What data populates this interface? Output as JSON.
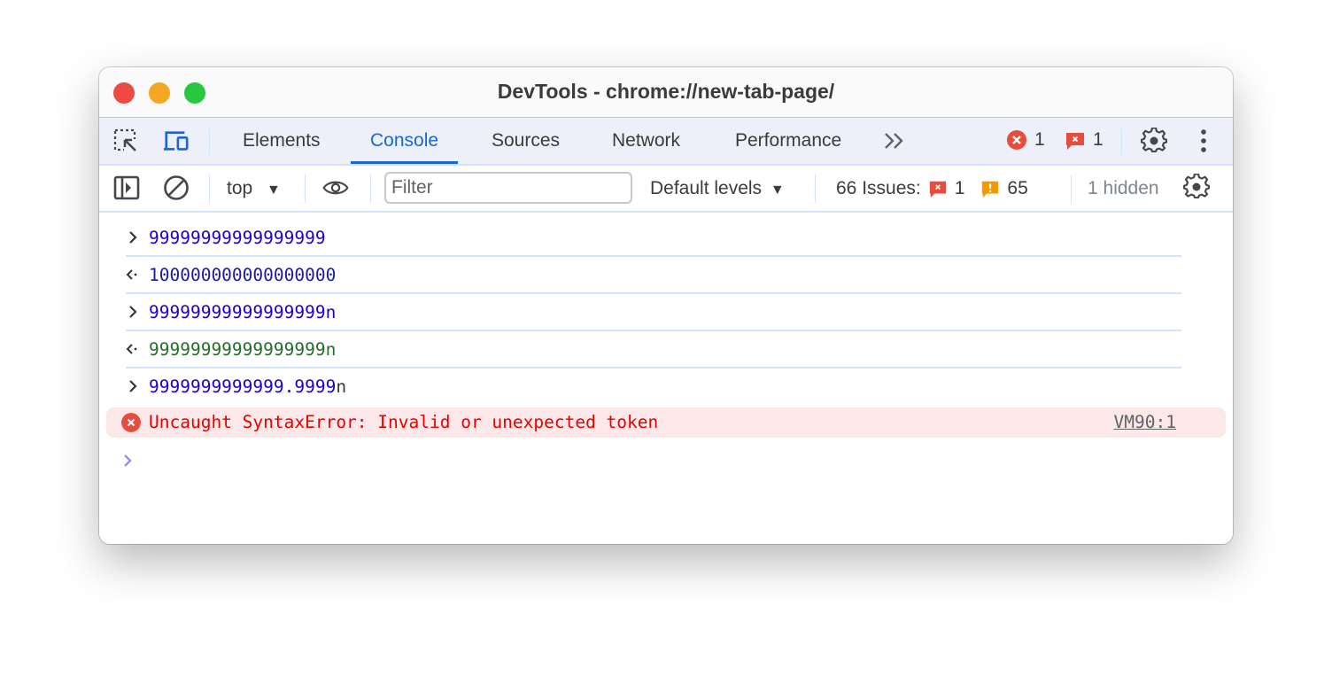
{
  "window": {
    "title": "DevTools - chrome://new-tab-page/"
  },
  "tabbar": {
    "tabs": [
      {
        "label": "Elements",
        "active": false
      },
      {
        "label": "Console",
        "active": true
      },
      {
        "label": "Sources",
        "active": false
      },
      {
        "label": "Network",
        "active": false
      },
      {
        "label": "Performance",
        "active": false
      }
    ],
    "more_tabs_icon": "double-chevron-right-icon",
    "error_count": "1",
    "issue_count": "1",
    "colors": {
      "accent": "#1a66d6",
      "error": "#e84c3d"
    }
  },
  "toolbar": {
    "context": "top",
    "filter_placeholder": "Filter",
    "filter_value": "",
    "levels": "Default levels",
    "issues_label": "66 Issues:",
    "issues_error_count": "1",
    "issues_warning_count": "65",
    "hidden_label": "1 hidden"
  },
  "console": {
    "entries": [
      {
        "kind": "input",
        "parts": [
          {
            "text": "99999999999999999",
            "style": "blue"
          }
        ]
      },
      {
        "kind": "output",
        "parts": [
          {
            "text": "100000000000000000",
            "style": "navy"
          }
        ]
      },
      {
        "kind": "input",
        "parts": [
          {
            "text": "99999999999999999n",
            "style": "blue"
          }
        ]
      },
      {
        "kind": "output",
        "parts": [
          {
            "text": "99999999999999999n",
            "style": "green"
          }
        ]
      },
      {
        "kind": "input",
        "parts": [
          {
            "text": "9999999999999.9999",
            "style": "blue"
          },
          {
            "text": "n",
            "style": "gray"
          }
        ]
      }
    ],
    "error": {
      "message": "Uncaught SyntaxError: Invalid or unexpected token",
      "source_link": "VM90:1"
    }
  }
}
